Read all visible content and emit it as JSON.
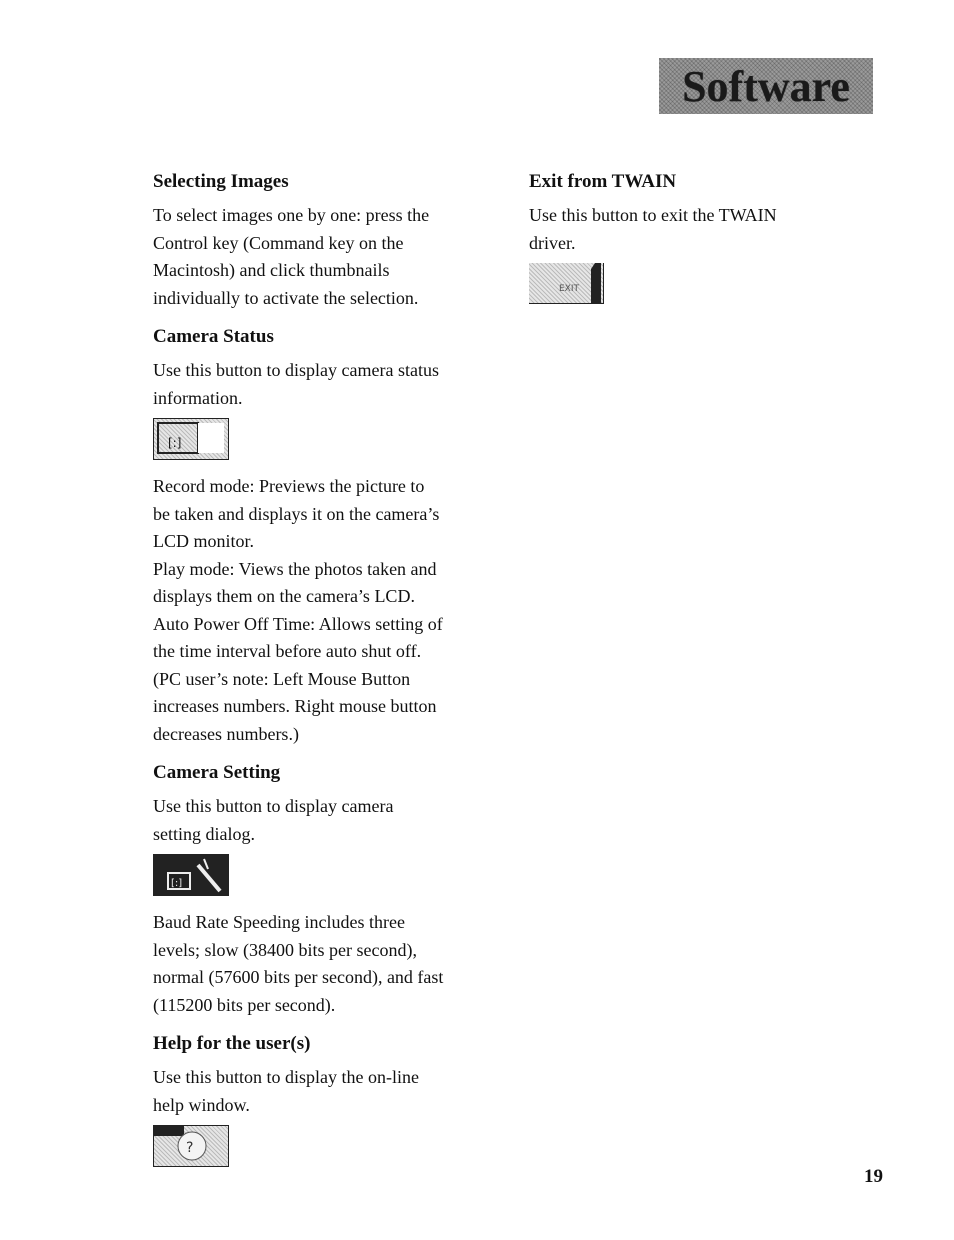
{
  "header": {
    "section_title": "Software"
  },
  "left_column": {
    "selecting_images": {
      "heading": "Selecting Images",
      "lines": [
        "To select images one by one: press the",
        "Control key (Command key on the",
        "Macintosh) and click thumbnails",
        "individually to activate the selection."
      ]
    },
    "camera_status": {
      "heading": "Camera Status",
      "lines": [
        "Use this button to display camera status",
        "information."
      ],
      "icon": "camera-status-icon",
      "record_mode": [
        "Record mode: Previews the picture to",
        "be taken and displays it on the camera’s",
        "LCD monitor."
      ],
      "play_mode": [
        "Play mode: Views the photos taken and",
        "displays them on the camera’s LCD."
      ],
      "auto_power": [
        "Auto Power Off Time: Allows setting of",
        "the time interval before auto shut off.",
        "(PC user’s note: Left Mouse Button",
        "increases numbers. Right mouse button",
        "decreases numbers.)"
      ]
    },
    "camera_setting": {
      "heading": "Camera Setting",
      "lines": [
        "Use this button to display camera",
        "setting dialog."
      ],
      "icon": "camera-setting-icon",
      "baud": [
        "Baud Rate Speeding includes three",
        "levels; slow (38400 bits per second),",
        "normal (57600 bits per second), and fast",
        "(115200 bits per second)."
      ]
    },
    "help": {
      "heading": "Help for the user(s)",
      "lines": [
        "Use this button to display the on-line",
        "help window."
      ],
      "icon": "help-icon"
    }
  },
  "right_column": {
    "exit": {
      "heading": "Exit from TWAIN",
      "lines": [
        "Use this button to exit the TWAIN",
        "driver."
      ],
      "icon": "exit-icon"
    }
  },
  "footer": {
    "page_number": "19"
  }
}
